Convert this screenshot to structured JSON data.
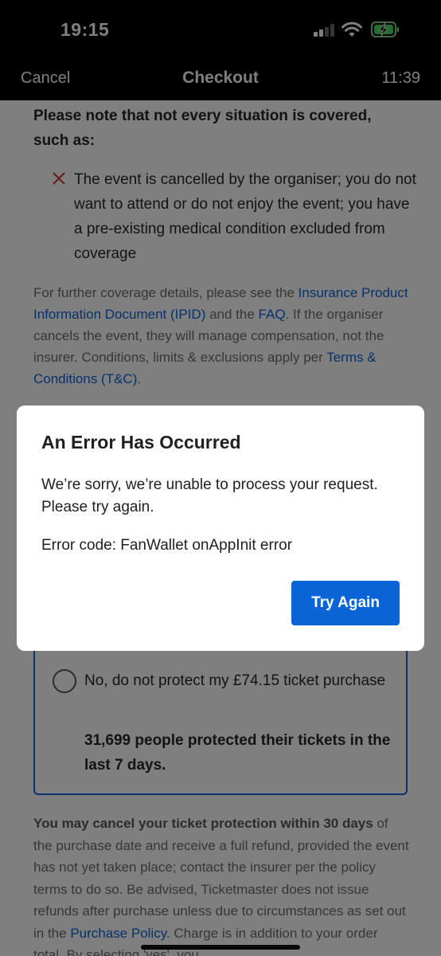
{
  "status_bar": {
    "time": "19:15"
  },
  "nav": {
    "cancel_label": "Cancel",
    "title": "Checkout",
    "timer": "11:39"
  },
  "content": {
    "notice_heading": "Please note that not every situation is covered, such as:",
    "excluded_item": "The event is cancelled by the organiser; you do not want to attend or do not enjoy the event; you have a pre-existing medical condition excluded from coverage",
    "details": {
      "text_1": "For further coverage details, please see the ",
      "link_ipid": "Insurance Product Information Document (IPID)",
      "text_2": " and the ",
      "link_faq": "FAQ",
      "text_3": ". If the organiser cancels the event, they will manage compensation, not the insurer. Conditions, limits & exclusions apply per ",
      "link_tc": "Terms & Conditions (T&C)",
      "text_4": "."
    },
    "decline_option": "No, do not protect my £74.15 ticket purchase",
    "social_proof": "31,699 people protected their tickets in the last 7 days.",
    "fine_print": {
      "bold": "You may cancel your ticket protection within 30 days",
      "text_1": " of the purchase date and receive a full refund, provided the event has not yet taken place; contact the insurer per the policy terms to do so. Be advised, Ticketmaster does not issue refunds after purchase unless due to circumstances as set out in the ",
      "link_policy": "Purchase Policy",
      "text_2": ". Charge is in addition to your order total. By selecting 'yes', you"
    }
  },
  "dialog": {
    "title": "An Error Has Occurred",
    "message": "We’re sorry, we’re unable to process your request. Please try again.",
    "error_code": "Error code: FanWallet onAppInit error",
    "button_label": "Try Again"
  },
  "colors": {
    "accent": "#0b64d6",
    "error": "#d32f2f",
    "nav_background": "#000000"
  },
  "icons": [
    "cellular-signal-icon",
    "wifi-icon",
    "battery-charging-icon",
    "close-x-icon"
  ]
}
